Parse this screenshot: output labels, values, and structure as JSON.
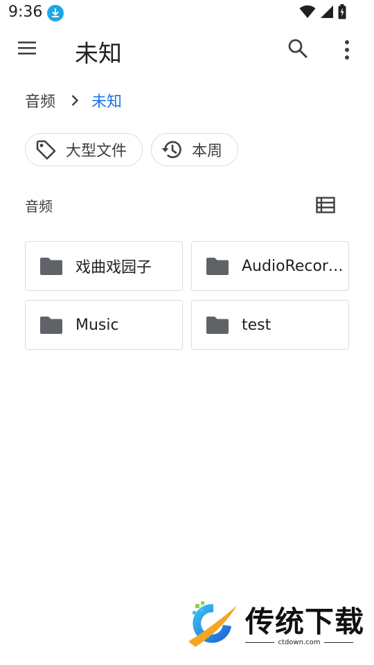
{
  "status_bar": {
    "time": "9:36",
    "download_icon": "download-arrow-icon",
    "wifi_icon": "wifi-icon",
    "signal_icon": "cell-signal-icon",
    "battery_icon": "battery-charging-icon"
  },
  "app_bar": {
    "title": "未知",
    "menu_icon": "hamburger-menu-icon",
    "search_icon": "search-icon",
    "more_icon": "more-vert-icon"
  },
  "breadcrumb": {
    "root": "音频",
    "separator_icon": "chevron-right-icon",
    "current": "未知"
  },
  "chips": [
    {
      "label": "大型文件",
      "icon": "tag-icon"
    },
    {
      "label": "本周",
      "icon": "history-icon"
    }
  ],
  "section": {
    "title": "音频",
    "view_icon": "list-view-icon"
  },
  "folders": [
    {
      "name": "戏曲戏园子",
      "icon": "folder-icon"
    },
    {
      "name": "AudioRecorder",
      "icon": "folder-icon"
    },
    {
      "name": "Music",
      "icon": "folder-icon"
    },
    {
      "name": "test",
      "icon": "folder-icon"
    }
  ],
  "watermark": {
    "title": "传统下载",
    "subtitle": "ctdown.com"
  },
  "colors": {
    "accent": "#1a73e8",
    "folder_icon": "#5f6368",
    "border": "#dadce0",
    "download_badge": "#1ea7e8"
  }
}
